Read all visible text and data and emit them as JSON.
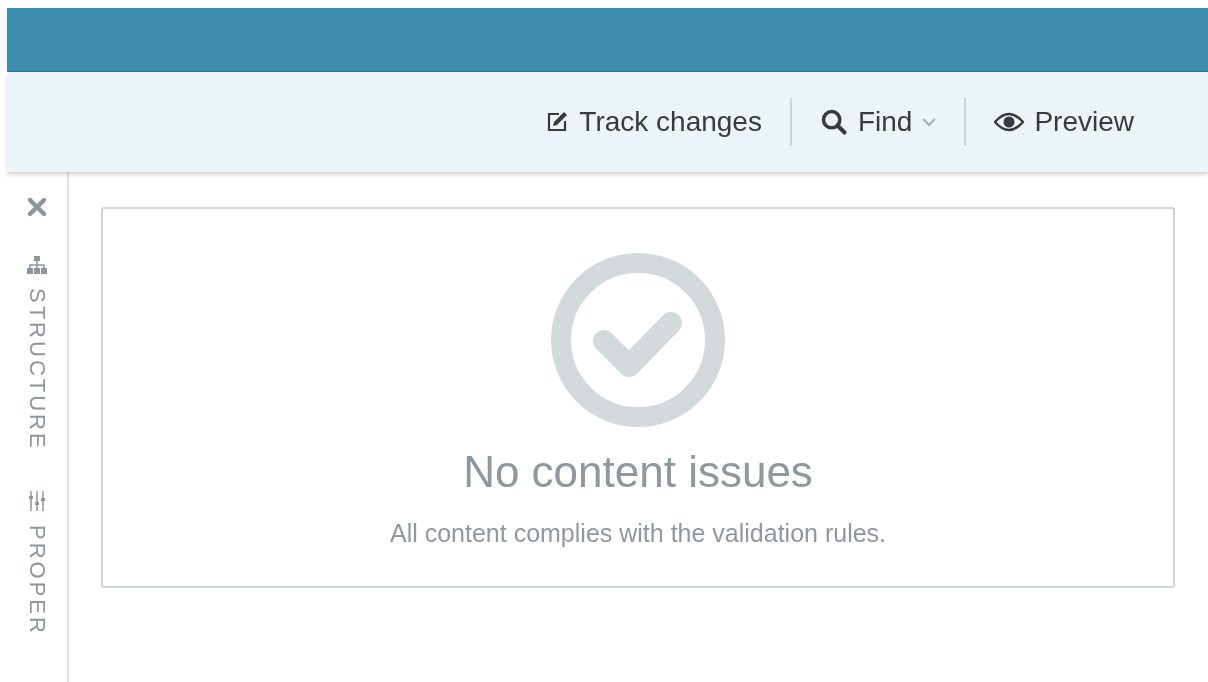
{
  "toolbar": {
    "buttons": [
      {
        "kind": "edit",
        "label": "Track changes"
      },
      {
        "kind": "search",
        "label": "Find",
        "dropdown": true
      },
      {
        "kind": "eye",
        "label": "Preview"
      }
    ]
  },
  "sidebar": {
    "tabs": [
      {
        "kind": "structure",
        "label": "STRUCTURE",
        "selected": false
      },
      {
        "kind": "properties",
        "label": "PROPER",
        "selected": false
      }
    ]
  },
  "panel": {
    "title": "No content issues",
    "message": "All content complies with the validation rules."
  }
}
